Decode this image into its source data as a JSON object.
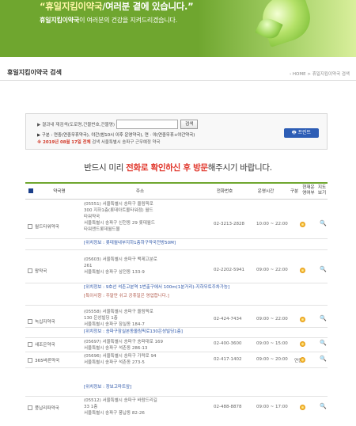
{
  "banner": {
    "slogan_main": "“휴일지킴이약국",
    "slogan_rest": "/여러분 곁에 있습니다.”",
    "slogan_sub_bold": "휴일지킴이약국",
    "slogan_sub_rest": "이 여러분의 건강을 지켜드리겠습니다."
  },
  "header": {
    "title": "휴일지킴이약국 검색",
    "breadcrumb": "› HOME > 휴일지킴이약국 검색"
  },
  "search": {
    "label": "▶ 결과내 재검색(도로명,건물번호,건물명)",
    "input_value": "",
    "button": "검색",
    "legend_text": "▶ 구분 : 연중(연중무휴약국), 야간(밤10시 이후 운영약국), 연 · 야(연중무휴+야간약국)",
    "date_notice_red": "※ 2019년 08월 17일 전체",
    "date_notice_rest": " 검색  서울특별시 송파구  근무예정 약국",
    "print_button": "🖶 프린트"
  },
  "notice": {
    "pre": "반드시 미리 ",
    "hl": "전화로 확인하신 후 방문",
    "post": "해주시기 바랍니다."
  },
  "columns": {
    "name": "약국명",
    "address": "주소",
    "tel": "전화번호",
    "hours": "운영시간",
    "kind": "구분",
    "status": "현재운영여부",
    "map": "지도보기"
  },
  "rows": [
    {
      "name": "월드타워약국",
      "address_lines": [
        "(05551) 서울특별시 송파구 올림픽로",
        "300 지하1층(롯데아트몰타워점) 월드",
        "타워약국",
        "서울특별시 송파구 신천동 29 롯데월드",
        "타워앤드롯데월드몰"
      ],
      "info": "[위치정보 : 롯데월내부지하1층하구약국전방50M]",
      "tel": "02-3213-2828",
      "hours": "10:00 ~ 22:00",
      "kind": ""
    },
    {
      "name": "왕약국",
      "address_lines": [
        "(05603) 서울특별시 송파구 백제고분로",
        "261",
        "서울특별시 송파구 삼전동 133-9"
      ],
      "info": "[위치정보 : 9호선 석촌고분역 1번출구에서 100m(1분거리)-지하무토주차가능]",
      "info2": "[특이사항 : 주말만 쉬고 공휴일은 영업합니다.]",
      "tel": "02-2202-5941",
      "hours": "09:00 ~ 22:00",
      "kind": ""
    },
    {
      "name": "녹십자약국",
      "address_lines": [
        "(05558) 서울특별시 송파구 올림픽로",
        "130 은성빌딩 1층",
        "서울특별시 송파구 잠실동 184-7"
      ],
      "info": "[위치정보 : 송파구잠실본동올림픽로130은성빌딩1층]",
      "tel": "02-424-7434",
      "hours": "09:00 ~ 22:00",
      "kind": ""
    },
    {
      "name": "새조은약국",
      "address_lines": [
        "(05697) 서울특별시 송파구 송파대로 169",
        "서울특별시 송파구 석촌동 286-13"
      ],
      "tel": "02-400-3600",
      "hours": "09:00 ~ 15:00",
      "kind": ""
    },
    {
      "name": "365바른약국",
      "address_lines": [
        "(05696) 서울특별시 송파구 가락로 94",
        "서울특별시 송파구 석촌동 273-5"
      ],
      "info": "[위치정보 : 장보고마트앞]",
      "tel": "02-417-1402",
      "hours": "09:00 ~ 20:00",
      "kind": "연중"
    },
    {
      "name": "풍납리파약국",
      "address_lines": [
        "(05512) 서울특별시 송파구 바람드리길",
        "33 1층",
        "서울특별시 송파구 풍납동 82-26"
      ],
      "tel": "02-488-8878",
      "hours": "09:00 ~ 17:00",
      "kind": ""
    }
  ],
  "icons": {
    "status": "sun-icon",
    "map": "magnifier-icon"
  }
}
